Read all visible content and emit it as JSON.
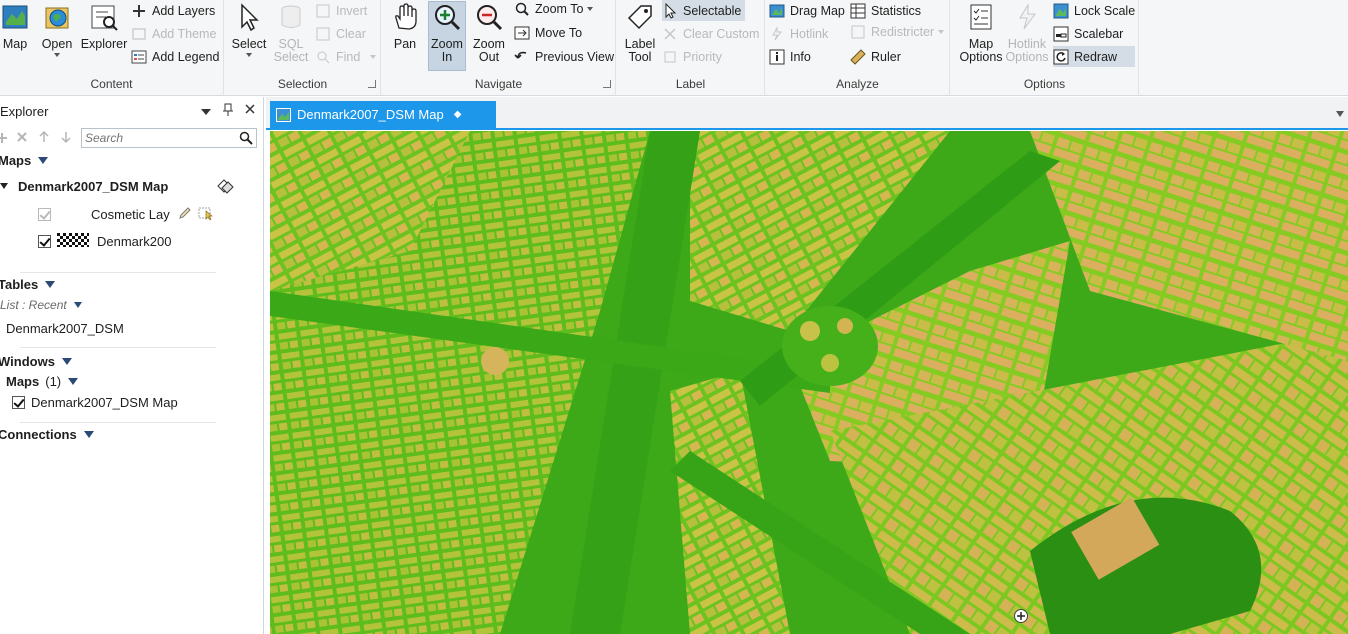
{
  "ribbon": {
    "content": {
      "label": "Content",
      "map": "Map",
      "open": "Open",
      "explorer": "Explorer",
      "add_layers": "Add Layers",
      "add_theme": "Add Theme",
      "add_legend": "Add Legend"
    },
    "selection": {
      "label": "Selection",
      "select": "Select",
      "sql_select_line1": "SQL",
      "sql_select_line2": "Select",
      "invert": "Invert",
      "clear": "Clear",
      "find": "Find"
    },
    "navigate": {
      "label": "Navigate",
      "pan": "Pan",
      "zoom_in_line1": "Zoom",
      "zoom_in_line2": "In",
      "zoom_out_line1": "Zoom",
      "zoom_out_line2": "Out",
      "zoom_to": "Zoom To",
      "move_to": "Move To",
      "previous_view": "Previous View"
    },
    "label_group": {
      "label": "Label",
      "label_tool_line1": "Label",
      "label_tool_line2": "Tool",
      "selectable": "Selectable",
      "clear_custom": "Clear Custom",
      "priority": "Priority"
    },
    "analyze": {
      "label": "Analyze",
      "drag_map": "Drag Map",
      "hotlink": "Hotlink",
      "info": "Info",
      "statistics": "Statistics",
      "redistricter": "Redistricter",
      "ruler": "Ruler"
    },
    "options": {
      "label": "Options",
      "map_options_line1": "Map",
      "map_options_line2": "Options",
      "hotlink_options_line1": "Hotlink",
      "hotlink_options_line2": "Options",
      "lock_scale": "Lock Scale",
      "scalebar": "Scalebar",
      "redraw": "Redraw"
    }
  },
  "explorer": {
    "title": "Explorer",
    "search_placeholder": "Search",
    "maps_header": "Maps",
    "map_name": "Denmark2007_DSM Map",
    "layers": [
      {
        "name": "Cosmetic Lay",
        "checked": true
      },
      {
        "name": "Denmark200",
        "checked": true
      }
    ],
    "tables_header": "Tables",
    "list_mode": "List : Recent",
    "table_item": "Denmark2007_DSM",
    "windows_header": "Windows",
    "windows_maps_label": "Maps",
    "windows_maps_count": "(1)",
    "window_item": "Denmark2007_DSM Map",
    "connections_header": "Connections"
  },
  "document": {
    "active_tab": "Denmark2007_DSM Map"
  },
  "colors": {
    "accent": "#1c97ea",
    "map_low": "#3da918",
    "map_mid": "#9fd021",
    "map_high": "#d7b45a"
  }
}
